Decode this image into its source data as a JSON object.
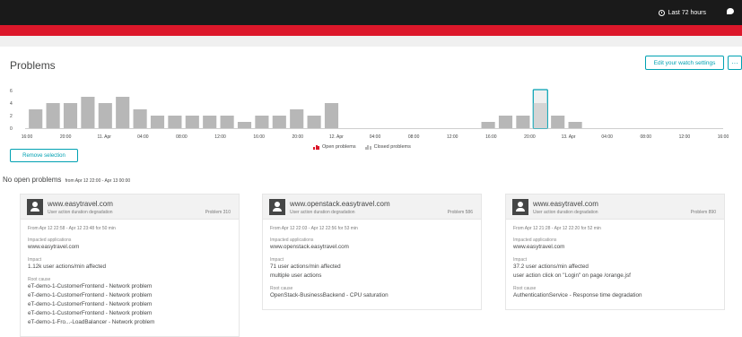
{
  "header": {
    "timeframe": "Last 72 hours"
  },
  "page": {
    "title": "Problems",
    "edit_button": "Edit your watch settings",
    "more_button": "···",
    "remove_selection": "Remove selection",
    "no_open_title": "No open problems",
    "no_open_range": "from Apr 12 22:00 - Apr 13 00:00"
  },
  "legend": {
    "open": "Open problems",
    "closed": "Closed problems"
  },
  "colors": {
    "accent": "#00a1b2",
    "brand_red": "#dc172a",
    "bar": "#b7b7b7",
    "selected_bar": "#d4d4d4",
    "topbar": "#1a1a1a"
  },
  "chart_data": {
    "type": "bar",
    "title": "",
    "xlabel": "",
    "ylabel": "",
    "ylim": [
      0,
      6
    ],
    "yticks": [
      "0",
      "2",
      "4",
      "6"
    ],
    "x_tick_labels": [
      "16:00",
      "20:00",
      "11. Apr",
      "04:00",
      "08:00",
      "12:00",
      "16:00",
      "20:00",
      "12. Apr",
      "04:00",
      "08:00",
      "12:00",
      "16:00",
      "20:00",
      "13. Apr",
      "04:00",
      "08:00",
      "12:00",
      "16:00"
    ],
    "bin_hours": 2,
    "values": [
      3,
      4,
      4,
      5,
      4,
      5,
      3,
      2,
      2,
      2,
      2,
      2,
      1,
      2,
      2,
      3,
      2,
      4,
      0,
      0,
      0,
      0,
      0,
      0,
      0,
      0,
      1,
      2,
      2,
      4,
      2,
      1,
      0,
      0,
      0,
      0,
      0,
      0,
      0,
      0
    ],
    "selected_index": 29,
    "series": [
      {
        "name": "Closed problems",
        "values": [
          3,
          4,
          4,
          5,
          4,
          5,
          3,
          2,
          2,
          2,
          2,
          2,
          1,
          2,
          2,
          3,
          2,
          4,
          0,
          0,
          0,
          0,
          0,
          0,
          0,
          0,
          1,
          2,
          2,
          4,
          2,
          1,
          0,
          0,
          0,
          0,
          0,
          0,
          0,
          0
        ]
      },
      {
        "name": "Open problems",
        "values": [
          0,
          0,
          0,
          0,
          0,
          0,
          0,
          0,
          0,
          0,
          0,
          0,
          0,
          0,
          0,
          0,
          0,
          0,
          0,
          0,
          0,
          0,
          0,
          0,
          0,
          0,
          0,
          0,
          0,
          0,
          0,
          0,
          0,
          0,
          0,
          0,
          0,
          0,
          0,
          0
        ]
      }
    ],
    "grid": false,
    "legend_position": "bottom-center"
  },
  "cards": [
    {
      "title": "www.easytravel.com",
      "subtitle": "User action duration degradation",
      "problem_id": "Problem 310",
      "from": "From Apr 12 22:58 - Apr 12 23:48 for 50 min",
      "impacted_label": "Impacted applications",
      "impacted": "www.easytravel.com",
      "impact_label": "Impact",
      "impact_lines": [
        "1.12k user actions/min affected"
      ],
      "root_label": "Root cause",
      "root_lines": [
        "eT-demo-1-CustomerFrontend - Network problem",
        "eT-demo-1-CustomerFrontend - Network problem",
        "eT-demo-1-CustomerFrontend - Network problem",
        "eT-demo-1-CustomerFrontend - Network problem",
        "eT-demo-1-Fro...-LoadBalancer - Network problem"
      ]
    },
    {
      "title": "www.openstack.easytravel.com",
      "subtitle": "User action duration degradation",
      "problem_id": "Problem 586",
      "from": "From Apr 12 22:03 - Apr 12 22:56 for 53 min",
      "impacted_label": "Impacted applications",
      "impacted": "www.openstack.easytravel.com",
      "impact_label": "Impact",
      "impact_lines": [
        "71 user actions/min affected",
        "multiple user actions"
      ],
      "root_label": "Root cause",
      "root_lines": [
        "OpenStack-BusinessBackend - CPU saturation"
      ]
    },
    {
      "title": "www.easytravel.com",
      "subtitle": "User action duration degradation",
      "problem_id": "Problem 890",
      "from": "From Apr 12 21:28 - Apr 12 22:20 for 52 min",
      "impacted_label": "Impacted applications",
      "impacted": "www.easytravel.com",
      "impact_label": "Impact",
      "impact_lines": [
        "37.2 user actions/min affected",
        "user action click on \"Login\" on page /orange.jsf"
      ],
      "root_label": "Root cause",
      "root_lines": [
        "AuthenticationService - Response time degradation"
      ]
    }
  ]
}
